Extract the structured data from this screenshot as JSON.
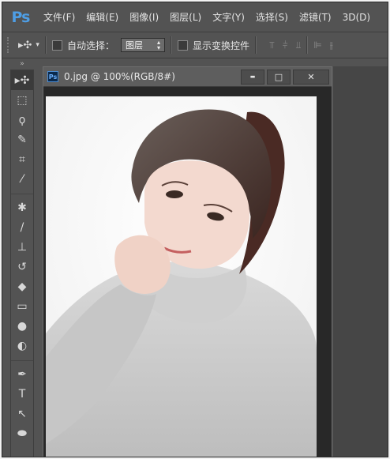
{
  "app": {
    "logo": "Ps",
    "accent": "#4e9ee5",
    "chrome_bg": "#535353"
  },
  "menu": [
    "文件(F)",
    "编辑(E)",
    "图像(I)",
    "图层(L)",
    "文字(Y)",
    "选择(S)",
    "滤镜(T)",
    "3D(D)"
  ],
  "options": {
    "tool_preset_icon": "move-tool-icon",
    "auto_select_label": "自动选择：",
    "auto_select_checked": false,
    "layer_select_value": "图层",
    "show_transform_label": "显示变换控件",
    "show_transform_checked": false,
    "align_icons": [
      "align-top-icon",
      "align-vcenter-icon",
      "align-bottom-icon",
      "align-left-icon",
      "align-hcenter-icon"
    ]
  },
  "toolbar": {
    "collapse_glyph": "»",
    "tools": [
      {
        "name": "move-tool",
        "glyph": "▸✣"
      },
      {
        "name": "marquee-tool",
        "glyph": "⬚"
      },
      {
        "name": "lasso-tool",
        "glyph": "ϙ"
      },
      {
        "name": "quick-selection-tool",
        "glyph": "✎"
      },
      {
        "name": "crop-tool",
        "glyph": "⌗"
      },
      {
        "name": "eyedropper-tool",
        "glyph": "⁄"
      },
      {
        "name": "healing-brush-tool",
        "glyph": "✱"
      },
      {
        "name": "brush-tool",
        "glyph": "/"
      },
      {
        "name": "clone-stamp-tool",
        "glyph": "⊥"
      },
      {
        "name": "history-brush-tool",
        "glyph": "↺"
      },
      {
        "name": "eraser-tool",
        "glyph": "◆"
      },
      {
        "name": "gradient-tool",
        "glyph": "▭"
      },
      {
        "name": "blur-tool",
        "glyph": "●"
      },
      {
        "name": "dodge-tool",
        "glyph": "◐"
      },
      {
        "name": "pen-tool",
        "glyph": "✒"
      },
      {
        "name": "type-tool",
        "glyph": "T"
      },
      {
        "name": "path-selection-tool",
        "glyph": "↖"
      },
      {
        "name": "ellipse-tool",
        "glyph": "⬬"
      }
    ]
  },
  "document": {
    "icon_label": "Ps",
    "title": "0.jpg @ 100%(RGB/8#)",
    "minimize_glyph": "▬",
    "restore_glyph": "□",
    "close_glyph": "✕"
  }
}
